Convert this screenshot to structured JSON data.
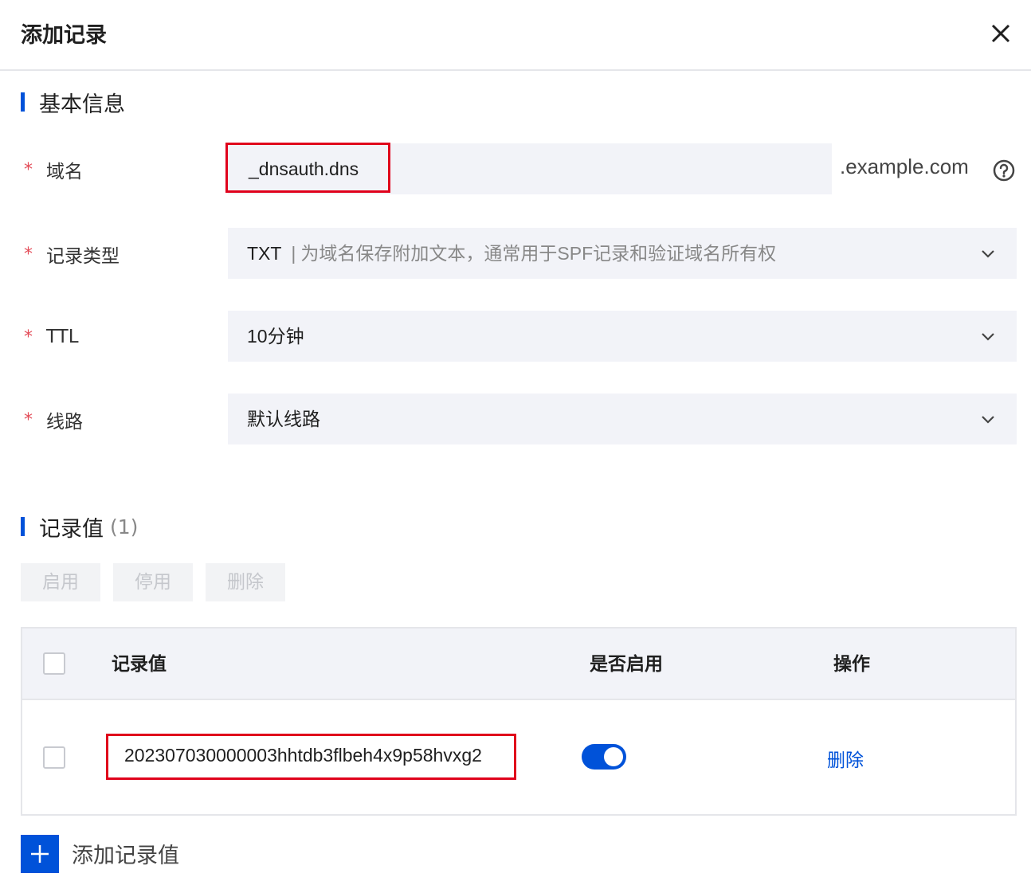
{
  "dialog": {
    "title": "添加记录",
    "close_icon": "close-icon"
  },
  "basic_info": {
    "section_title": "基本信息",
    "required_mark": "*",
    "domain": {
      "label": "域名",
      "value": "_dnsauth.dns",
      "suffix": ".example.com",
      "help_icon": "question-circle-icon"
    },
    "record_type": {
      "label": "记录类型",
      "value": "TXT",
      "separator": "|",
      "description": "为域名保存附加文本，通常用于SPF记录和验证域名所有权"
    },
    "ttl": {
      "label": "TTL",
      "value": "10分钟"
    },
    "line": {
      "label": "线路",
      "value": "默认线路"
    }
  },
  "record_values": {
    "section_title": "记录值",
    "count": "(1)",
    "actions": {
      "enable": "启用",
      "disable": "停用",
      "delete": "删除"
    },
    "table": {
      "columns": [
        "记录值",
        "是否启用",
        "操作"
      ],
      "rows": [
        {
          "value": "202307030000003hhtdb3flbeh4x9p58hvxg2",
          "enabled": true,
          "action": "删除"
        }
      ]
    },
    "add_button": {
      "icon": "plus-icon",
      "label": "添加记录值"
    }
  },
  "colors": {
    "accent": "#0052d9",
    "required": "#e34d59",
    "highlight_box": "#e0001b",
    "field_bg": "#f2f3f8"
  }
}
